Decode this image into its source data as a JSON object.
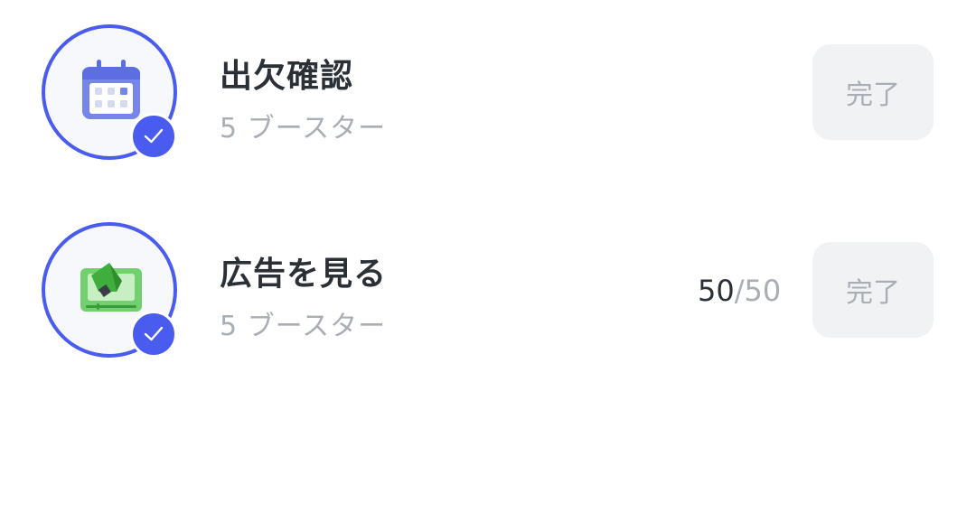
{
  "tasks": [
    {
      "title": "出欠確認",
      "reward": "5 ブースター",
      "button_label": "完了",
      "icon": "calendar-icon"
    },
    {
      "title": "広告を見る",
      "reward": "5 ブースター",
      "progress_current": "50",
      "progress_total": "/50",
      "button_label": "完了",
      "icon": "megaphone-icon"
    }
  ],
  "colors": {
    "accent": "#4a5cf0",
    "title_text": "#2b2f36",
    "muted_text": "#a9adb4",
    "button_bg": "#f1f2f4",
    "calendar_icon": "#6e7de8",
    "megaphone_icon": "#5cc45a"
  }
}
